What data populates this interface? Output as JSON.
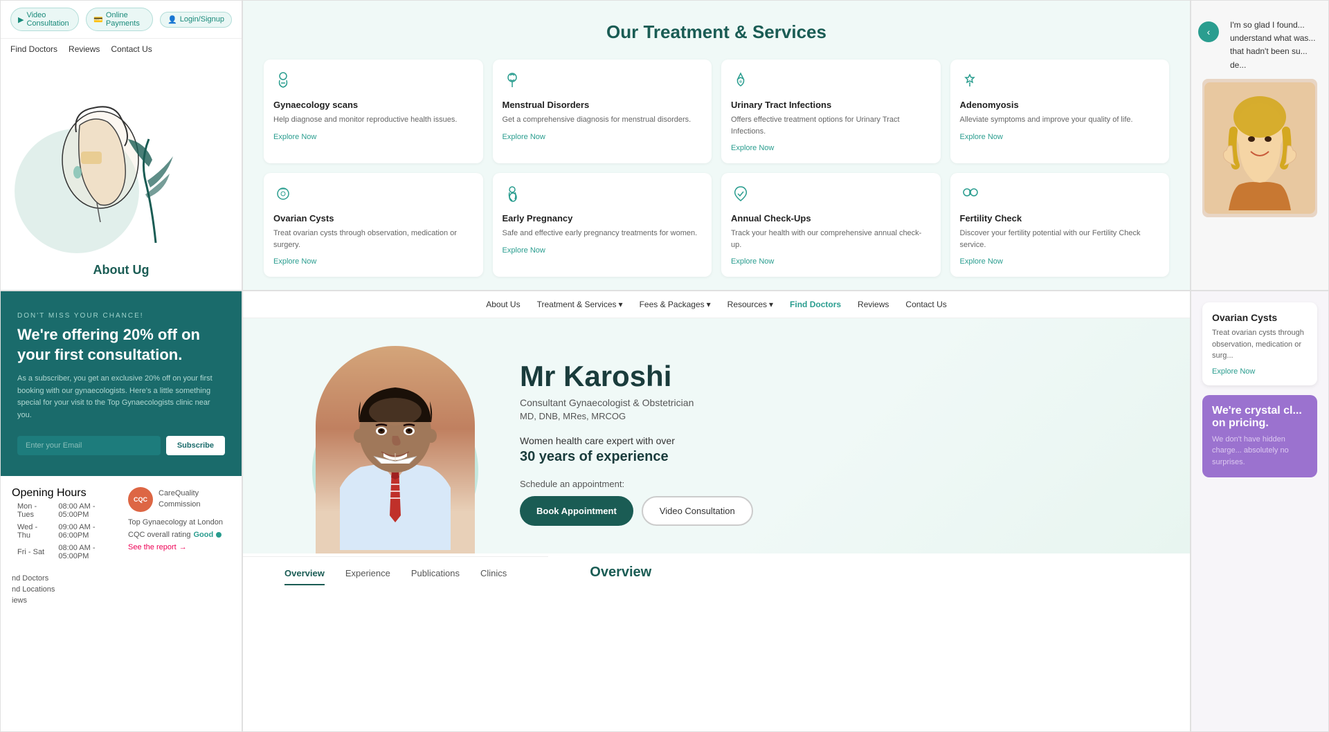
{
  "header": {
    "video_consultation": "Video Consultation",
    "online_payments": "Online Payments",
    "login_signup": "Login/Signup",
    "nav_find_doctors": "Find Doctors",
    "nav_reviews": "Reviews",
    "nav_contact": "Contact Us"
  },
  "services_section": {
    "title": "Our Treatment & Services",
    "services": [
      {
        "id": 1,
        "icon": "⚕",
        "title": "Gynaecology scans",
        "desc": "Help diagnose and monitor reproductive health issues.",
        "explore": "Explore Now"
      },
      {
        "id": 2,
        "icon": "♀",
        "title": "Menstrual Disorders",
        "desc": "Get a comprehensive diagnosis for menstrual disorders.",
        "explore": "Explore Now"
      },
      {
        "id": 3,
        "icon": "🔬",
        "title": "Urinary Tract Infections",
        "desc": "Offers effective treatment options for Urinary Tract Infections.",
        "explore": "Explore Now"
      },
      {
        "id": 4,
        "icon": "🏥",
        "title": "Adenomyosis",
        "desc": "Alleviate symptoms and improve your quality of life.",
        "explore": "Explore Now"
      },
      {
        "id": 5,
        "icon": "⭕",
        "title": "Ovarian Cysts",
        "desc": "Treat ovarian cysts through observation, medication or surgery.",
        "explore": "Explore Now"
      },
      {
        "id": 6,
        "icon": "🌱",
        "title": "Early Pregnancy",
        "desc": "Safe and effective early pregnancy treatments for women.",
        "explore": "Explore Now"
      },
      {
        "id": 7,
        "icon": "📋",
        "title": "Annual Check-Ups",
        "desc": "Track your health with our comprehensive annual check-up.",
        "explore": "Explore Now"
      },
      {
        "id": 8,
        "icon": "🔍",
        "title": "Fertility Check",
        "desc": "Discover your fertility potential with our Fertility Check service.",
        "explore": "Explore Now"
      }
    ]
  },
  "testimonial": {
    "text": "I'm so glad I found... understand what was... that hadn't been su... de..."
  },
  "promo": {
    "small_text": "DON'T MISS YOUR CHANCE!",
    "title": "We're offering 20% off on your first consultation.",
    "desc": "As a subscriber, you get an exclusive 20% off on your first booking with our gynaecologists. Here's a little something special for your visit to the Top Gynaecologists clinic near you.",
    "email_placeholder": "Enter your Email",
    "subscribe_btn": "Subscribe"
  },
  "opening_hours": {
    "title": "Opening Hours",
    "rows": [
      {
        "days": "Mon - Tues",
        "hours": "08:00 AM - 05:00PM"
      },
      {
        "days": "Wed - Thu",
        "hours": "09:00 AM - 06:00PM"
      },
      {
        "days": "Fri - Sat",
        "hours": "08:00 AM - 05:00PM"
      }
    ]
  },
  "cqc": {
    "line1": "Top Gynaecology at London",
    "label": "CQC overall rating",
    "rating": "Good",
    "report": "See the report"
  },
  "footer_nav": {
    "items": [
      "nd Doctors",
      "nd Locations",
      "iews"
    ]
  },
  "doctor_nav": {
    "items": [
      "About Us",
      "Treatment & Services",
      "Fees & Packages",
      "Resources",
      "Find Doctors",
      "Reviews",
      "Contact Us"
    ]
  },
  "doctor": {
    "name": "Mr Karoshi",
    "title": "Consultant Gynaecologist & Obstetrician",
    "credentials": "MD, DNB, MRes, MRCOG",
    "exp_text": "Women health care expert with over",
    "exp_years": "30 years of experience",
    "schedule_label": "Schedule an appointment:",
    "book_btn": "Book Appointment",
    "video_btn": "Video Consultation"
  },
  "overview": {
    "tabs": [
      "Overview",
      "Experience",
      "Publications",
      "Clinics"
    ],
    "active_tab": "Overview",
    "title": "Overview"
  },
  "ovarian_cysts_card": {
    "title": "Ovarian Cysts",
    "desc": "Treat ovarian cysts through observation, medication or surg...",
    "explore": "Explore Now"
  },
  "pricing_card": {
    "title": "We're crystal cl... on pricing.",
    "desc": "We don't have hidden charge... absolutely no surprises."
  },
  "about_ug": "About Ug",
  "find_doctors_bottom": "Find Doctors"
}
